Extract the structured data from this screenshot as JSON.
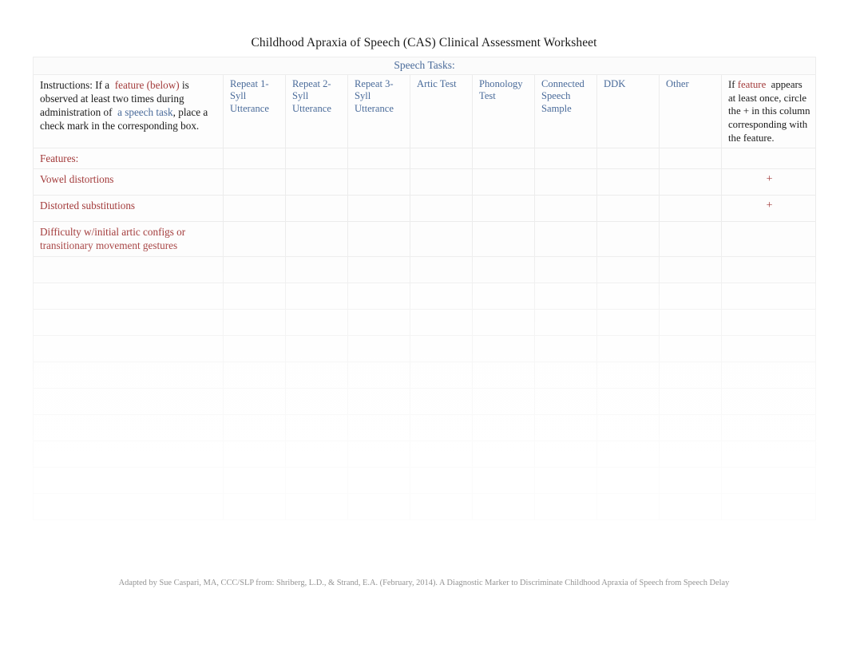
{
  "document": {
    "title": "Childhood Apraxia of Speech (CAS) Clinical Assessment Worksheet",
    "tasks_banner": "Speech Tasks:",
    "footer": "Adapted by Sue Caspari, MA, CCC/SLP from: Shriberg, L.D., & Strand, E.A. (February, 2014). A Diagnostic Marker to Discriminate Childhood Apraxia of Speech from Speech Delay"
  },
  "colors": {
    "feature_red": "#a33b3b",
    "task_blue": "#4a6b9a",
    "body_black": "#1a1a1a",
    "grid_line": "#ececec"
  },
  "instructions": {
    "part1": "Instructions: If a",
    "highlight_feature": "feature (below)",
    "part2": "is observed at least two times during administration of",
    "highlight_task": "a speech task",
    "part3": ", place a check mark in the corresponding box."
  },
  "plus_column_header": {
    "part1": "If",
    "highlight": "feature",
    "part2": "appears at least once, circle the + in this column corresponding with the feature."
  },
  "task_columns": [
    {
      "label": "Repeat 1-Syll Utterance"
    },
    {
      "label": "Repeat 2-Syll Utterance"
    },
    {
      "label": "Repeat 3- Syll Utterance"
    },
    {
      "label": "Artic Test"
    },
    {
      "label": "Phonology Test"
    },
    {
      "label": "Connected Speech Sample"
    },
    {
      "label": "DDK"
    },
    {
      "label": "Other"
    }
  ],
  "features_heading": "Features:",
  "features": [
    {
      "label": "Vowel distortions",
      "plus": "+",
      "fade": 0
    },
    {
      "label": "Distorted substitutions",
      "plus": "+",
      "fade": 0
    },
    {
      "label": "Difficulty w/initial artic configs or transitionary movement gestures",
      "plus": "",
      "fade": 0
    },
    {
      "label": "",
      "plus": "",
      "fade": 1
    },
    {
      "label": "",
      "plus": "",
      "fade": 2
    },
    {
      "label": "",
      "plus": "",
      "fade": 3
    },
    {
      "label": "",
      "plus": "",
      "fade": 4
    },
    {
      "label": "",
      "plus": "",
      "fade": 5
    },
    {
      "label": "",
      "plus": "",
      "fade": 6
    },
    {
      "label": "",
      "plus": "",
      "fade": 7
    },
    {
      "label": "",
      "plus": "",
      "fade": 8
    },
    {
      "label": "",
      "plus": "",
      "fade": 8
    },
    {
      "label": "",
      "plus": "",
      "fade": 8
    }
  ]
}
